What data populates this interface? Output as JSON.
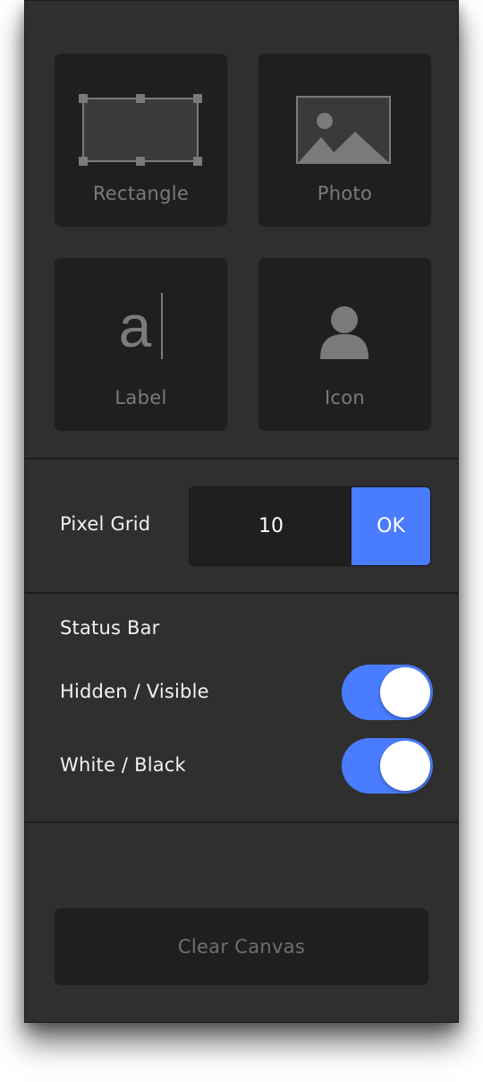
{
  "tools": {
    "rectangle_label": "Rectangle",
    "photo_label": "Photo",
    "label_label": "Label",
    "label_glyph": "a",
    "icon_label": "Icon"
  },
  "pixel_grid": {
    "label": "Pixel Grid",
    "value": "10",
    "ok_label": "OK"
  },
  "status_bar": {
    "heading": "Status Bar",
    "visibility_label": "Hidden / Visible",
    "visibility_on": true,
    "style_label": "White / Black",
    "style_on": true
  },
  "clear_label": "Clear Canvas",
  "colors": {
    "accent": "#4a7cff",
    "panel": "#2f2f2f",
    "tile": "#1f1f1f"
  }
}
